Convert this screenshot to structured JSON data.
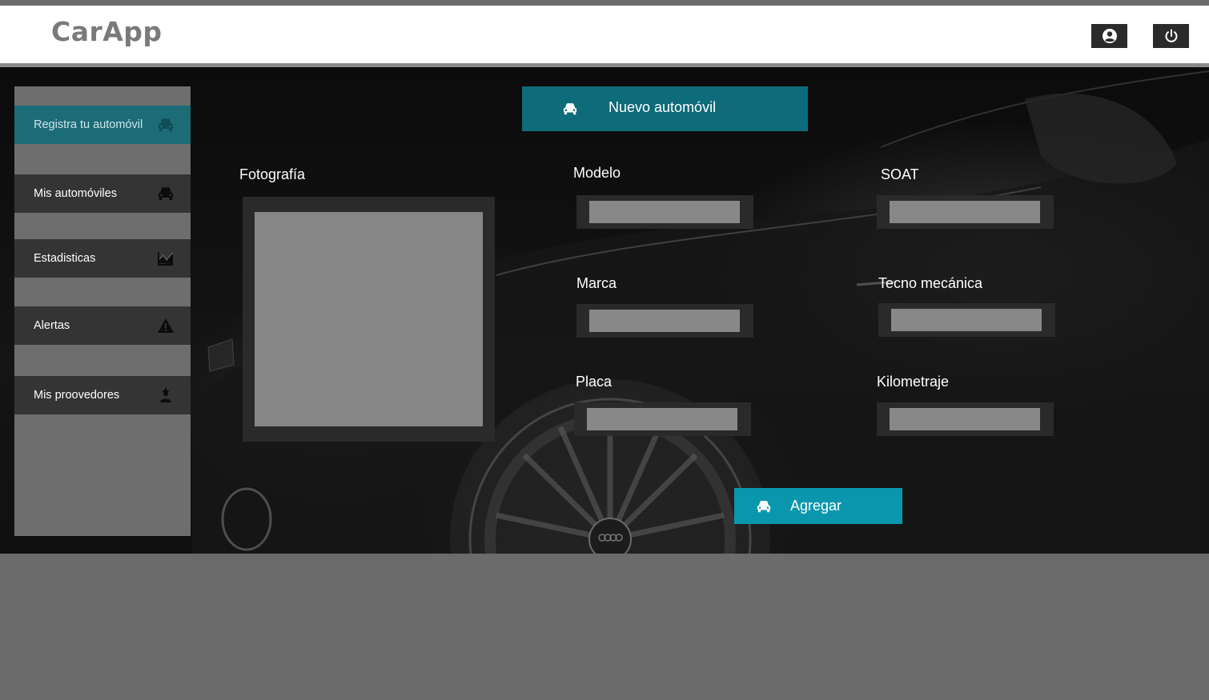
{
  "app": {
    "title": "CarApp"
  },
  "header": {
    "profile_icon": "user-circle-icon",
    "logout_icon": "power-icon"
  },
  "sidebar": {
    "items": [
      {
        "label": "Registra tu automóvil",
        "icon": "car-icon",
        "active": true
      },
      {
        "label": "Mis automóviles",
        "icon": "car-icon",
        "active": false
      },
      {
        "label": "Estadisticas",
        "icon": "chart-area-icon",
        "active": false
      },
      {
        "label": "Alertas",
        "icon": "warning-icon",
        "active": false
      },
      {
        "label": "Mis proovedores",
        "icon": "worker-icon",
        "active": false
      }
    ]
  },
  "main": {
    "title": "Nuevo automóvil",
    "photo_label": "Fotografía",
    "fields": {
      "modelo": {
        "label": "Modelo",
        "value": ""
      },
      "soat": {
        "label": "SOAT",
        "value": ""
      },
      "marca": {
        "label": "Marca",
        "value": ""
      },
      "tecno": {
        "label": "Tecno mecánica",
        "value": ""
      },
      "placa": {
        "label": "Placa",
        "value": ""
      },
      "kilometraje": {
        "label": "Kilometraje",
        "value": ""
      }
    },
    "add_label": "Agregar"
  },
  "colors": {
    "accent": "#0a97ad",
    "active_nav": "#1c6c78",
    "title_bar": "#0e6b79"
  }
}
